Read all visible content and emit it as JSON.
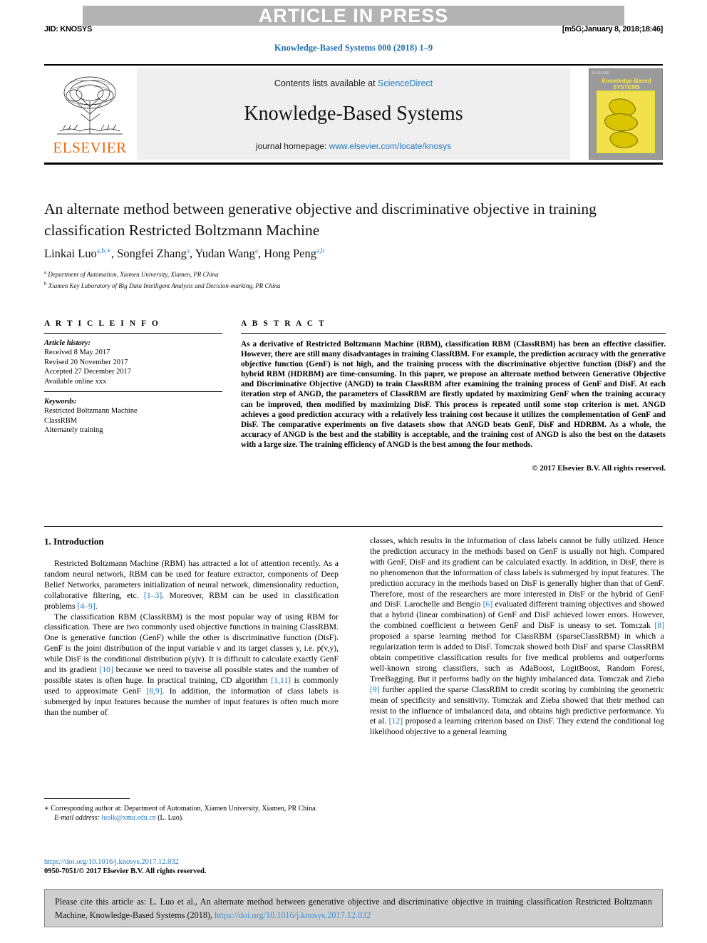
{
  "header": {
    "banner": "ARTICLE IN PRESS",
    "jid": "JID: KNOSYS",
    "stamp": "[m5G;January 8, 2018;18:46]",
    "journal_ref": "Knowledge-Based Systems 000 (2018) 1–9"
  },
  "masthead": {
    "publisher": "ELSEVIER",
    "contents_prefix": "Contents lists available at ",
    "contents_link": "ScienceDirect",
    "journal_title": "Knowledge-Based Systems",
    "homepage_prefix": "journal homepage: ",
    "homepage_url": "www.elsevier.com/locate/knosys",
    "cover_title": "Knowledge-Based SYSTEMS",
    "cover_corner": "ELSEVIER"
  },
  "article": {
    "title": "An alternate method between generative objective and discriminative objective in training classification Restricted Boltzmann Machine",
    "authors_html": "Linkai Luo<sup>a,b,∗</sup>, Songfei Zhang<sup>a</sup>, Yudan Wang<sup>a</sup>, Hong Peng<sup>a,b</sup>",
    "affiliation_a": "Department of Automation, Xiamen University, Xiamen, PR China",
    "affiliation_b": "Xiamen Key Laboratory of Big Data Intelligent Analysis and Decision-marking, PR China"
  },
  "info": {
    "heading": "A R T I C L E   I N F O",
    "history_label": "Article history:",
    "history": [
      "Received 8 May 2017",
      "Revised 20 November 2017",
      "Accepted 27 December 2017",
      "Available online xxx"
    ],
    "keywords_label": "Keywords:",
    "keywords": [
      "Restricted Boltzmann Machine",
      "ClassRBM",
      "Alternately training"
    ]
  },
  "abstract": {
    "heading": "A B S T R A C T",
    "text": "As a derivative of Restricted Boltzmann Machine (RBM), classification RBM (ClassRBM) has been an effective classifier. However, there are still many disadvantages in training ClassRBM. For example, the prediction accuracy with the generative objective function (GenF) is not high, and the training process with the discriminative objective function (DisF) and the hybrid RBM (HDRBM) are time-consuming. In this paper, we propose an alternate method between Generative Objective and Discriminative Objective (ANGD) to train ClassRBM after examining the training process of GenF and DisF. At each iteration step of ANGD, the parameters of ClassRBM are firstly updated by maximizing GenF when the training accuracy can be improved, then modified by maximizing DisF. This process is repeated until some stop criterion is met. ANGD achieves a good prediction accuracy with a relatively less training cost because it utilizes the complementation of GenF and DisF. The comparative experiments on five datasets show that ANGD beats GenF, DisF and HDRBM. As a whole, the accuracy of ANGD is the best and the stability is acceptable, and the training cost of ANGD is also the best on the datasets with a large size. The training efficiency of ANGD is the best among the four methods.",
    "copyright": "© 2017 Elsevier B.V. All rights reserved."
  },
  "body": {
    "section_heading": "1. Introduction",
    "left_paragraphs": [
      "Restricted Boltzmann Machine (RBM) has attracted a lot of attention recently. As a random neural network, RBM can be used for feature extractor, components of Deep Belief Networks, parameters initialization of neural network, dimensionality reduction, collaborative filtering, etc. [1–3]. Moreover, RBM can be used in classification problems [4–9].",
      "The classification RBM (ClassRBM) is the most popular way of using RBM for classification. There are two commonly used objective functions in training ClassRBM. One is generative function (GenF) while the other is discriminative function (DisF). GenF is the joint distribution of the input variable v and its target classes y, i.e. p(v,y), while DisF is the conditional distribution p(y|v). It is difficult to calculate exactly GenF and its gradient [10] because we need to traverse all possible states and the number of possible states is often huge. In practical training, CD algorithm [1,11] is commonly used to approximate GenF [8,9]. In addition, the information of class labels is submerged by input features because the number of input features is often much more than the number of"
    ],
    "right_paragraphs": [
      "classes, which results in the information of class labels cannot be fully utilized. Hence the prediction accuracy in the methods based on GenF is usually not high. Compared with GenF, DisF and its gradient can be calculated exactly. In addition, in DisF, there is no phenomenon that the information of class labels is submerged by input features. The prediction accuracy in the methods based on DisF is generally higher than that of GenF. Therefore, most of the researchers are more interested in DisF or the hybrid of GenF and DisF. Larochelle and Bengio [6] evaluated different training objectives and showed that a hybrid (linear combination) of GenF and DisF achieved lower errors. However, the combined coefficient α between GenF and DisF is uneasy to set. Tomczak [8] proposed a sparse learning method for ClassRBM (sparseClassRBM) in which a regularization term is added to DisF. Tomczak showed both DisF and sparse ClassRBM obtain competitive classification results for five medical problems and outperforms well-known strong classifiers, such as AdaBoost, LogitBoost, Random Forest, TreeBagging. But it performs badly on the highly imbalanced data. Tomczak and Zieba [9] further applied the sparse ClassRBM to credit scoring by combining the geometric mean of specificity and sensitivity. Tomczak and Zieba showed that their method can resist to the influence of imbalanced data, and obtains high predictive performance. Yu et al. [12] proposed a learning criterion based on DisF. They extend the conditional log likelihood objective to a general learning"
    ]
  },
  "footnote": {
    "corresponding": "∗ Corresponding author at: Department of Automation, Xiamen University, Xiamen, PR China.",
    "email_label": "E-mail address:",
    "email": "luolk@xmu.edu.cn",
    "email_suffix": " (L. Luo).",
    "doi": "https://doi.org/10.1016/j.knosys.2017.12.032",
    "issn_copyright": "0950-7051/© 2017 Elsevier B.V. All rights reserved."
  },
  "cite_box": {
    "text_before": "Please cite this article as: L. Luo et al., An alternate method between generative objective and discriminative objective in training classification Restricted Boltzmann Machine, Knowledge-Based Systems (2018), ",
    "link": "https://doi.org/10.1016/j.knosys.2017.12.032"
  },
  "colors": {
    "link": "#1f78c1",
    "banner_bg": "#b3b3b3",
    "panel_bg": "#efefef",
    "cite_bg": "#cfcfcf",
    "elsevier_orange": "#eb6608"
  }
}
